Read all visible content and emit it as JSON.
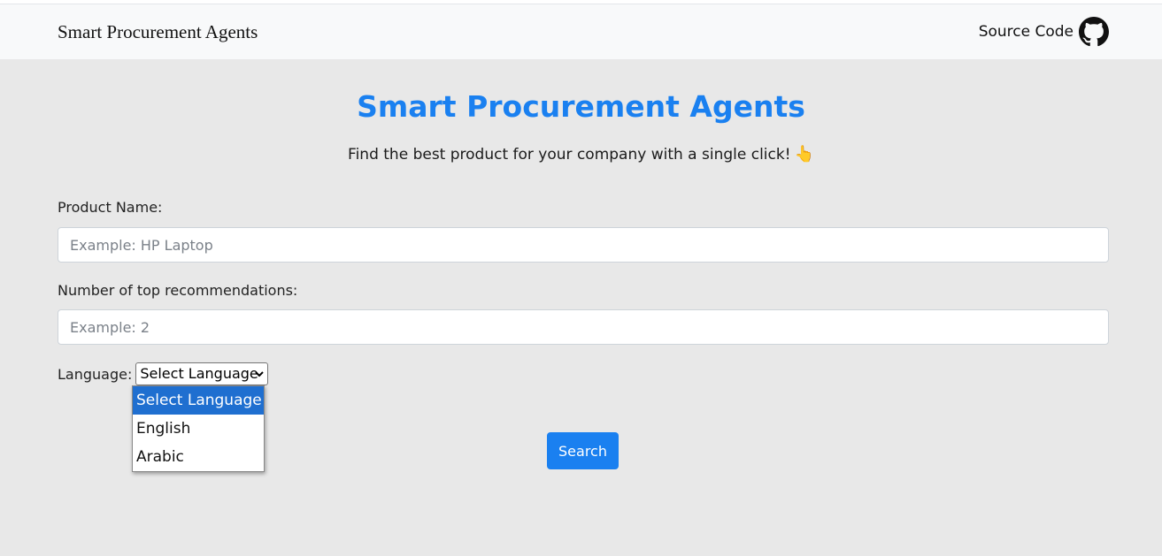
{
  "navbar": {
    "brand": "Smart Procurement Agents",
    "source_label": "Source Code",
    "source_icon": "github-icon"
  },
  "main": {
    "title": "Smart Procurement Agents",
    "subtitle": "Find the best product for your company with a single click!",
    "subtitle_emoji": "👆"
  },
  "form": {
    "product_label": "Product Name:",
    "product_placeholder": "Example: HP Laptop",
    "product_value": "",
    "count_label": "Number of top recommendations:",
    "count_placeholder": "Example: 2",
    "count_value": "",
    "language_label": "Language:",
    "language_selected": "Select Language",
    "language_options": [
      "Select Language",
      "English",
      "Arabic"
    ],
    "search_label": "Search"
  },
  "colors": {
    "accent": "#1a80f0",
    "page_bg": "#e8e8e8",
    "navbar_bg": "#f8f9fa",
    "option_highlight": "#1f6fd0"
  }
}
